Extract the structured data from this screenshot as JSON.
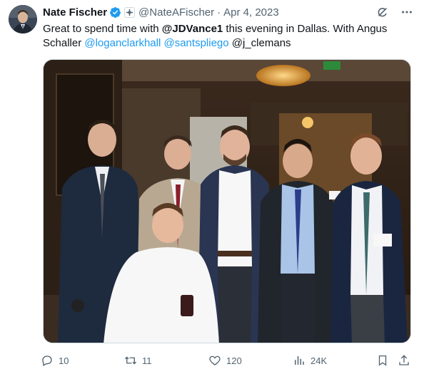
{
  "author": {
    "name": "Nate Fischer",
    "handle": "@NateAFischer",
    "separator": "·",
    "date": "Apr 4, 2023"
  },
  "tweet": {
    "text_intro": "Great to spend time with ",
    "mention_1": "@JDVance1",
    "text_mid": " this evening in Dallas. With Angus Schaller ",
    "mention_2": "@loganclarkhall",
    "space_1": " ",
    "mention_3": "@santspliego",
    "space_2": " ",
    "mention_4": "@j_clemans"
  },
  "actions": {
    "replies": "10",
    "reposts": "11",
    "likes": "120",
    "views": "24K"
  },
  "colors": {
    "accent": "#1d9bf0",
    "text": "#0f1419",
    "muted": "#536471",
    "verified": "#1d9bf0"
  },
  "icons": {
    "verified": "verified-badge-icon",
    "affiliate": "affiliate-badge-icon",
    "grok": "grok-icon",
    "more": "more-icon",
    "reply": "reply-icon",
    "repost": "repost-icon",
    "like": "heart-icon",
    "views": "views-icon",
    "bookmark": "bookmark-icon",
    "share": "share-icon"
  }
}
